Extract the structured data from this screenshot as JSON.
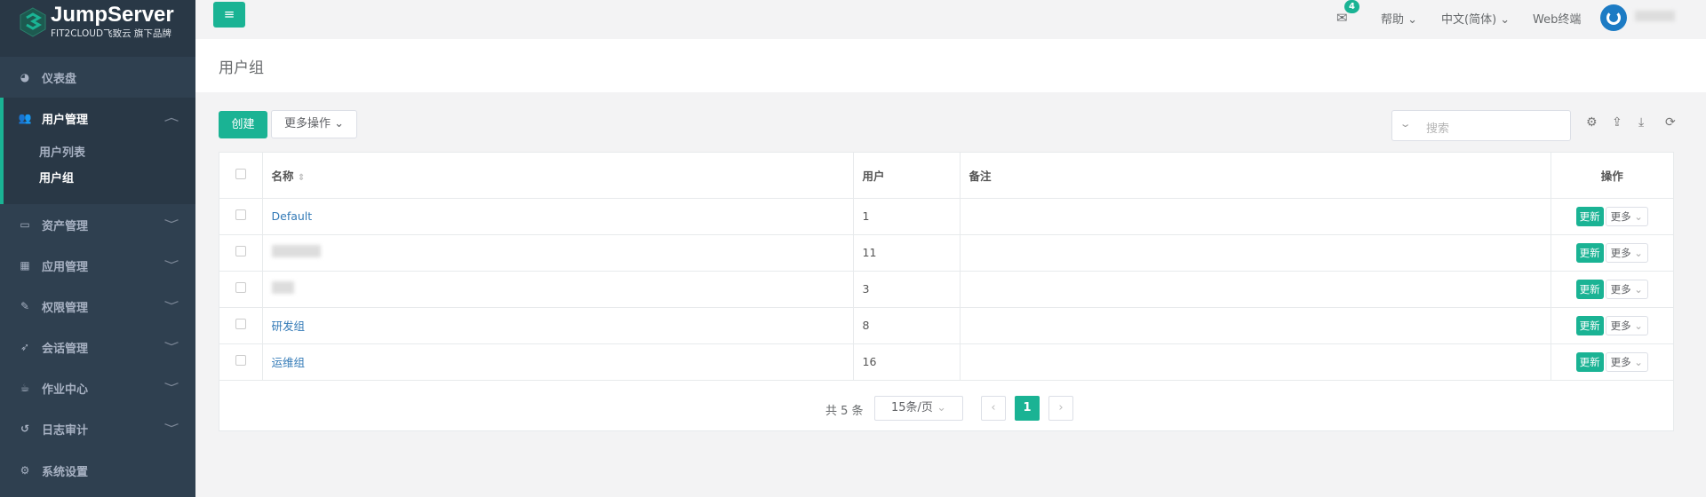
{
  "brand": {
    "name": "JumpServer",
    "tagline": "FIT2CLOUD飞致云 旗下品牌"
  },
  "sidebar": {
    "dashboard": "仪表盘",
    "user_mgmt": {
      "label": "用户管理",
      "children": [
        "用户列表",
        "用户组"
      ]
    },
    "items": [
      "资产管理",
      "应用管理",
      "权限管理",
      "会话管理",
      "作业中心",
      "日志审计",
      "系统设置"
    ]
  },
  "topbar": {
    "mail_count": "4",
    "help": "帮助",
    "language": "中文(简体)",
    "web_terminal": "Web终端"
  },
  "page": {
    "title": "用户组"
  },
  "toolbar": {
    "create": "创建",
    "more_actions": "更多操作",
    "search_placeholder": "搜索"
  },
  "table": {
    "headers": {
      "name": "名称",
      "users": "用户",
      "comment": "备注",
      "actions": "操作"
    },
    "rows": [
      {
        "name": "Default",
        "users": "1",
        "comment": ""
      },
      {
        "name": "",
        "users": "11",
        "comment": ""
      },
      {
        "name": "",
        "users": "3",
        "comment": ""
      },
      {
        "name": "研发组",
        "users": "8",
        "comment": ""
      },
      {
        "name": "运维组",
        "users": "16",
        "comment": ""
      }
    ],
    "update_label": "更新",
    "more_label": "更多"
  },
  "pagination": {
    "total": "共 5 条",
    "page_size": "15条/页",
    "current": "1"
  },
  "colors": {
    "accent": "#1ab394",
    "sidebar": "#2f4050"
  }
}
